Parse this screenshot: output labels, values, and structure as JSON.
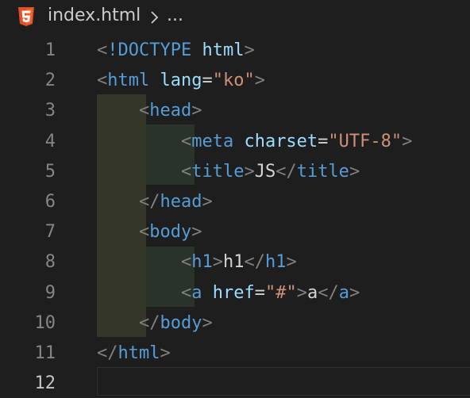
{
  "breadcrumb": {
    "file": "index.html",
    "more": "...",
    "file_icon": "html5-icon",
    "separator_icon": "chevron-right-icon"
  },
  "editor": {
    "line_numbers": [
      "1",
      "2",
      "3",
      "4",
      "5",
      "6",
      "7",
      "8",
      "9",
      "10",
      "11",
      "12"
    ],
    "active_line": "12",
    "lines": [
      {
        "tokens": [
          [
            "b",
            "<"
          ],
          [
            "t",
            "!DOCTYPE"
          ],
          [
            "x",
            " "
          ],
          [
            "a",
            "html"
          ],
          [
            "b",
            ">"
          ]
        ]
      },
      {
        "tokens": [
          [
            "b",
            "<"
          ],
          [
            "t",
            "html"
          ],
          [
            "x",
            " "
          ],
          [
            "a",
            "lang"
          ],
          [
            "x",
            "="
          ],
          [
            "s",
            "\"ko\""
          ],
          [
            "b",
            ">"
          ]
        ]
      },
      {
        "tokens": [
          [
            "x",
            "    "
          ],
          [
            "b",
            "<"
          ],
          [
            "t",
            "head"
          ],
          [
            "b",
            ">"
          ]
        ]
      },
      {
        "tokens": [
          [
            "x",
            "        "
          ],
          [
            "b",
            "<"
          ],
          [
            "t",
            "meta"
          ],
          [
            "x",
            " "
          ],
          [
            "a",
            "charset"
          ],
          [
            "x",
            "="
          ],
          [
            "s",
            "\"UTF-8\""
          ],
          [
            "b",
            ">"
          ]
        ]
      },
      {
        "tokens": [
          [
            "x",
            "        "
          ],
          [
            "b",
            "<"
          ],
          [
            "t",
            "title"
          ],
          [
            "b",
            ">"
          ],
          [
            "x",
            "JS"
          ],
          [
            "b",
            "</"
          ],
          [
            "t",
            "title"
          ],
          [
            "b",
            ">"
          ]
        ]
      },
      {
        "tokens": [
          [
            "x",
            "    "
          ],
          [
            "b",
            "</"
          ],
          [
            "t",
            "head"
          ],
          [
            "b",
            ">"
          ]
        ]
      },
      {
        "tokens": [
          [
            "x",
            "    "
          ],
          [
            "b",
            "<"
          ],
          [
            "t",
            "body"
          ],
          [
            "b",
            ">"
          ]
        ]
      },
      {
        "tokens": [
          [
            "x",
            "        "
          ],
          [
            "b",
            "<"
          ],
          [
            "t",
            "h1"
          ],
          [
            "b",
            ">"
          ],
          [
            "x",
            "h1"
          ],
          [
            "b",
            "</"
          ],
          [
            "t",
            "h1"
          ],
          [
            "b",
            ">"
          ]
        ]
      },
      {
        "tokens": [
          [
            "x",
            "        "
          ],
          [
            "b",
            "<"
          ],
          [
            "t",
            "a"
          ],
          [
            "x",
            " "
          ],
          [
            "a",
            "href"
          ],
          [
            "x",
            "="
          ],
          [
            "s",
            "\"#\""
          ],
          [
            "b",
            ">"
          ],
          [
            "x",
            "a"
          ],
          [
            "b",
            "</"
          ],
          [
            "t",
            "a"
          ],
          [
            "b",
            ">"
          ]
        ]
      },
      {
        "tokens": [
          [
            "x",
            "    "
          ],
          [
            "b",
            "</"
          ],
          [
            "t",
            "body"
          ],
          [
            "b",
            ">"
          ]
        ]
      },
      {
        "tokens": [
          [
            "b",
            "</"
          ],
          [
            "t",
            "html"
          ],
          [
            "b",
            ">"
          ]
        ]
      },
      {
        "tokens": []
      }
    ]
  },
  "colors": {
    "background": "#1e1e1e",
    "tag": "#569cd6",
    "bracket": "#808080",
    "attribute": "#9cdcfe",
    "string": "#ce9178",
    "text": "#d4d4d4",
    "line_number": "#858585",
    "html5_icon": "#e44d26"
  }
}
